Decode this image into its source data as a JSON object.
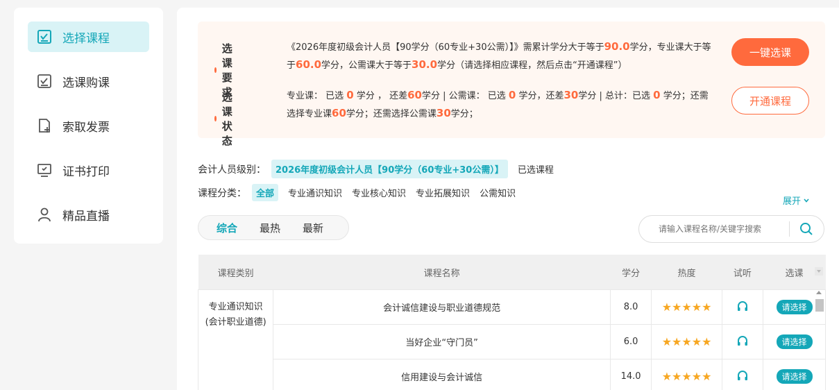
{
  "sidebar": {
    "items": [
      {
        "label": "选择课程",
        "icon": "checkbox-icon",
        "active": true
      },
      {
        "label": "选课购课",
        "icon": "checkbox-icon",
        "active": false
      },
      {
        "label": "索取发票",
        "icon": "document-add-icon",
        "active": false
      },
      {
        "label": "证书打印",
        "icon": "monitor-icon",
        "active": false
      },
      {
        "label": "精品直播",
        "icon": "user-icon",
        "active": false
      }
    ]
  },
  "requirements": {
    "label1": "选课要求",
    "text1_parts": [
      "《2026年度初级会计人员【90学分（60专业+30公需）】》需累计学分大于等于",
      "90.0",
      "学分，专业课大于等于",
      "60.0",
      "学分，公需课大于等于",
      "30.0",
      "学分（请选择相应课程，然后点击“开通课程”）"
    ],
    "label2": "选课状态",
    "text2_parts": [
      "专业课： 已选 ",
      "0",
      " 学分 ， 还差",
      "60",
      "学分 | 公需课： 已选 ",
      "0",
      " 学分，还差",
      "30",
      "学分 | 总计：已选 ",
      "0",
      " 学分；还需选择专业课",
      "60",
      "学分；还需选择公需课",
      "30",
      "学分；"
    ],
    "btn_one_click": "一键选课",
    "btn_open": "开通课程"
  },
  "filters": {
    "level_label": "会计人员级别：",
    "level_value": "2026年度初级会计人员【90学分（60专业+30公需）】",
    "selected_courses": "已选课程",
    "category_label": "课程分类：",
    "categories": [
      "全部",
      "专业通识知识",
      "专业核心知识",
      "专业拓展知识",
      "公需知识"
    ],
    "expand": "展开"
  },
  "sort_tabs": [
    "综合",
    "最热",
    "最新"
  ],
  "search": {
    "placeholder": "请输入课程名称/关键字搜索"
  },
  "table": {
    "headers": [
      "课程类别",
      "课程名称",
      "学分",
      "热度",
      "试听",
      "选课"
    ],
    "category_cell_1": "专业通识知识",
    "category_cell_2": "(会计职业道德)",
    "rows": [
      {
        "name": "会计诚信建设与职业道德规范",
        "credit": "8.0",
        "stars": "★★★★★",
        "action": "请选择"
      },
      {
        "name": "当好企业“守门员”",
        "credit": "6.0",
        "stars": "★★★★★",
        "action": "请选择"
      },
      {
        "name": "信用建设与会计诚信",
        "credit": "14.0",
        "stars": "★★★★★",
        "action": "请选择"
      }
    ]
  },
  "colors": {
    "accent": "#14a7b8",
    "orange": "#ff6a3d",
    "star": "#f7a722"
  }
}
